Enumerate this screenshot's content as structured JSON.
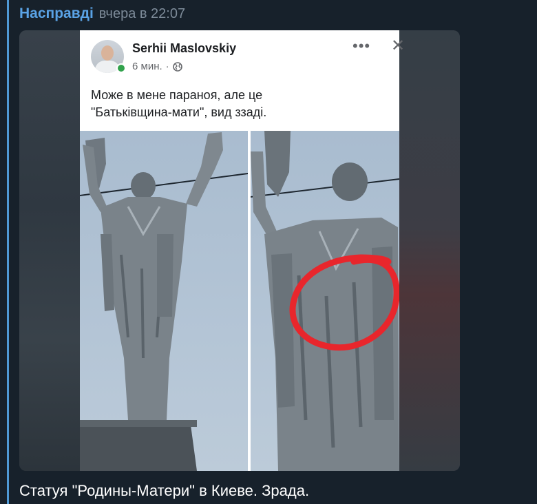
{
  "message": {
    "channel_name": "Насправді",
    "timestamp": "вчера в 22:07",
    "caption": "Статуя \"Родины-Матери\" в Киеве. Зрада."
  },
  "post": {
    "author": "Serhii Maslovskiy",
    "time": "6 мин.",
    "separator": "·",
    "text_lines": [
      "Може в мене параноя, але це",
      "\"Батьківщина-мати\", вид ззаді."
    ]
  },
  "icons": {
    "more": "more-options-icon",
    "close": "close-icon",
    "privacy": "globe-icon"
  },
  "colors": {
    "background": "#17212b",
    "channel_name": "#5aa3e6",
    "quote_bar": "#4f9ad6",
    "highlight_circle": "#e8262c"
  }
}
